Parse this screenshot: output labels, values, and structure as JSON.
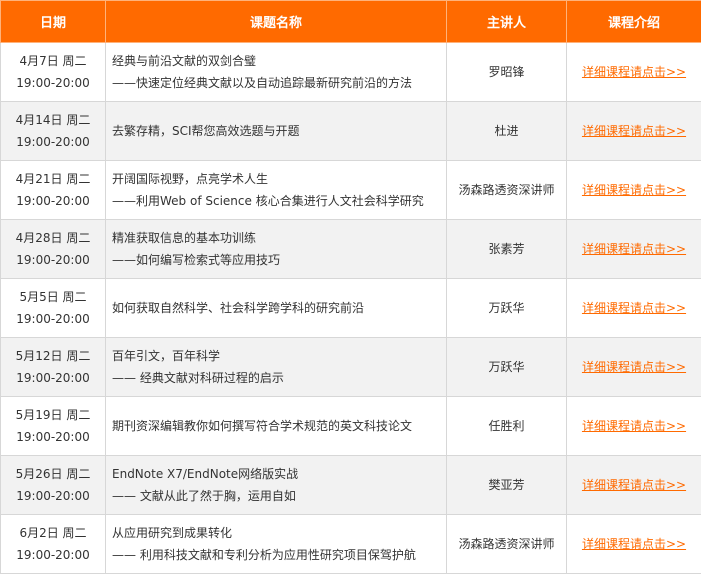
{
  "header": {
    "date": "日期",
    "title": "课题名称",
    "speaker": "主讲人",
    "intro": "课程介绍"
  },
  "rows": [
    {
      "date": "4月7日 周二",
      "time": "19:00-20:00",
      "title_main": "经典与前沿文献的双剑合璧",
      "title_sub": "——快速定位经典文献以及自动追踪最新研究前沿的方法",
      "speaker": "罗昭锋",
      "link": "详细课程请点击>>"
    },
    {
      "date": "4月14日 周二",
      "time": "19:00-20:00",
      "title_main": "去繁存精，SCI帮您高效选题与开题",
      "title_sub": "",
      "speaker": "杜进",
      "link": "详细课程请点击>>"
    },
    {
      "date": "4月21日 周二",
      "time": "19:00-20:00",
      "title_main": "开阔国际视野，点亮学术人生",
      "title_sub": "——利用Web of Science 核心合集进行人文社会科学研究",
      "speaker": "汤森路透资深讲师",
      "link": "详细课程请点击>>"
    },
    {
      "date": "4月28日 周二",
      "time": "19:00-20:00",
      "title_main": "精准获取信息的基本功训练",
      "title_sub": "——如何编写检索式等应用技巧",
      "speaker": "张素芳",
      "link": "详细课程请点击>>"
    },
    {
      "date": "5月5日 周二",
      "time": "19:00-20:00",
      "title_main": "如何获取自然科学、社会科学跨学科的研究前沿",
      "title_sub": "",
      "speaker": "万跃华",
      "link": "详细课程请点击>>"
    },
    {
      "date": "5月12日 周二",
      "time": "19:00-20:00",
      "title_main": "百年引文，百年科学",
      "title_sub": "—— 经典文献对科研过程的启示",
      "speaker": "万跃华",
      "link": "详细课程请点击>>"
    },
    {
      "date": "5月19日 周二",
      "time": "19:00-20:00",
      "title_main": "期刊资深编辑教你如何撰写符合学术规范的英文科技论文",
      "title_sub": "",
      "speaker": "任胜利",
      "link": "详细课程请点击>>"
    },
    {
      "date": "5月26日 周二",
      "time": "19:00-20:00",
      "title_main": "EndNote X7/EndNote网络版实战",
      "title_sub": "—— 文献从此了然于胸，运用自如",
      "speaker": "樊亚芳",
      "link": "详细课程请点击>>"
    },
    {
      "date": "6月2日 周二",
      "time": "19:00-20:00",
      "title_main": "从应用研究到成果转化",
      "title_sub": "—— 利用科技文献和专利分析为应用性研究项目保驾护航",
      "speaker": "汤森路透资深讲师",
      "link": "详细课程请点击>>"
    }
  ],
  "colors": {
    "header_bg": "#ff6a00",
    "link": "#ff6a00",
    "row_alt": "#f2f2f2",
    "border": "#d7d7d7"
  }
}
